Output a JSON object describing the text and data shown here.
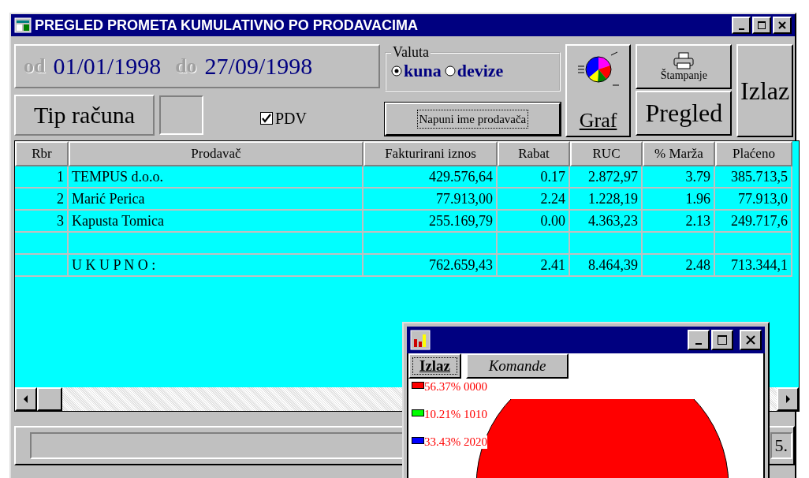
{
  "window": {
    "title": "PREGLED PROMETA KUMULATIVNO PO PRODAVACIMA"
  },
  "period": {
    "from_label": "od",
    "from": "01/01/1998",
    "to_label": "do",
    "to": "27/09/1998"
  },
  "valuta": {
    "label": "Valuta",
    "options": [
      {
        "label": "kuna",
        "selected": true
      },
      {
        "label": "devize",
        "selected": false
      }
    ]
  },
  "buttons": {
    "graf": "Graf",
    "stampanje": "Štampanje",
    "pregled": "Pregled",
    "izlaz": "Izlaz",
    "napuni": "Napuni ime prodavača"
  },
  "tip_racuna": {
    "label": "Tip računa"
  },
  "pdv": {
    "label": "PDV",
    "checked": true
  },
  "table": {
    "columns": [
      "Rbr",
      "Prodavač",
      "Fakturirani iznos",
      "Rabat",
      "RUC",
      "% Marža",
      "Plaćeno"
    ],
    "rows": [
      [
        "1",
        "TEMPUS d.o.o.",
        "429.576,64",
        "0.17",
        "2.872,97",
        "3.79",
        "385.713,5"
      ],
      [
        "2",
        "Marić Perica",
        "77.913,00",
        "2.24",
        "1.228,19",
        "1.96",
        "77.913,0"
      ],
      [
        "3",
        "Kapusta Tomica",
        "255.169,79",
        "0.00",
        "4.363,23",
        "2.13",
        "249.717,6"
      ],
      []
    ],
    "total_row": {
      "label": "U K U P N O :",
      "values": [
        "762.659,43",
        "2.41",
        "8.464,39",
        "2.48",
        "713.344,1"
      ]
    }
  },
  "status_bar": {
    "text": "5."
  },
  "chart_window": {
    "tabs": [
      {
        "label": "Izlaz",
        "selected": true
      },
      {
        "label": "Komande",
        "selected": false
      }
    ],
    "legend": [
      {
        "text": "56.37% 0000",
        "color": "#ff0000"
      },
      {
        "text": "10.21% 1010",
        "color": "#00ff00"
      },
      {
        "text": "33.43% 2020",
        "color": "#0000ff"
      }
    ]
  }
}
